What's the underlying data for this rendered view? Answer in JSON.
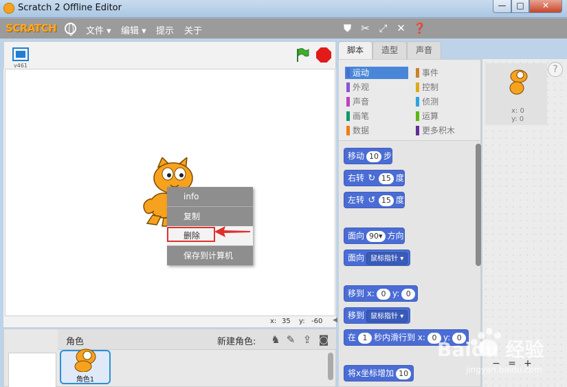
{
  "window": {
    "title": "Scratch 2 Offline Editor",
    "min": "—",
    "max": "□",
    "close": "✕"
  },
  "menubar": {
    "logo": "SCRATCH",
    "items": [
      "文件 ▾",
      "编辑 ▾",
      "提示",
      "关于"
    ]
  },
  "stage": {
    "version": "v461",
    "x_label": "x:",
    "x_value": "35",
    "y_label": "y:",
    "y_value": "-60"
  },
  "context_menu": {
    "items": [
      "info",
      "复制",
      "删除",
      "保存到计算机"
    ]
  },
  "sprites": {
    "title": "角色",
    "new_sprite": "新建角色:",
    "sprite_name": "角色1"
  },
  "tabs": [
    "脚本",
    "造型",
    "声音"
  ],
  "categories": [
    {
      "label": "运动",
      "color": "#4a6cd4",
      "active": true
    },
    {
      "label": "事件",
      "color": "#c88330"
    },
    {
      "label": "外观",
      "color": "#8a55d7"
    },
    {
      "label": "控制",
      "color": "#e1a91a"
    },
    {
      "label": "声音",
      "color": "#bb42c3"
    },
    {
      "label": "侦测",
      "color": "#2ca5e2"
    },
    {
      "label": "画笔",
      "color": "#0e9a6c"
    },
    {
      "label": "运算",
      "color": "#5cb712"
    },
    {
      "label": "数据",
      "color": "#ee7d16"
    },
    {
      "label": "更多积木",
      "color": "#632d99"
    }
  ],
  "blocks": {
    "move": {
      "pre": "移动",
      "v": "10",
      "post": "步"
    },
    "turn_right": {
      "pre": "右转",
      "icon": "↻",
      "v": "15",
      "post": "度"
    },
    "turn_left": {
      "pre": "左转",
      "icon": "↺",
      "v": "15",
      "post": "度"
    },
    "point_dir": {
      "pre": "面向",
      "v": "90▾",
      "post": "方向"
    },
    "point_towards": {
      "pre": "面向",
      "dd": "鼠标指针 ▾"
    },
    "goto_xy": {
      "pre": "移到 x:",
      "x": "0",
      "mid": "y:",
      "y": "0"
    },
    "goto": {
      "pre": "移到",
      "dd": "鼠标指针 ▾"
    },
    "glide": {
      "pre": "在",
      "t": "1",
      "mid": "秒内滑行到 x:",
      "x": "0",
      "mid2": "y:",
      "y": "0"
    },
    "change_x": {
      "pre": "将x坐标增加",
      "v": "10"
    }
  },
  "sprite_info": {
    "x": "x: 0",
    "y": "y: 0"
  },
  "help": "?",
  "zoom": [
    "−",
    "=",
    "+"
  ],
  "watermark": {
    "brand": "Baidu 经验",
    "url": "jingyan.baidu.com"
  }
}
